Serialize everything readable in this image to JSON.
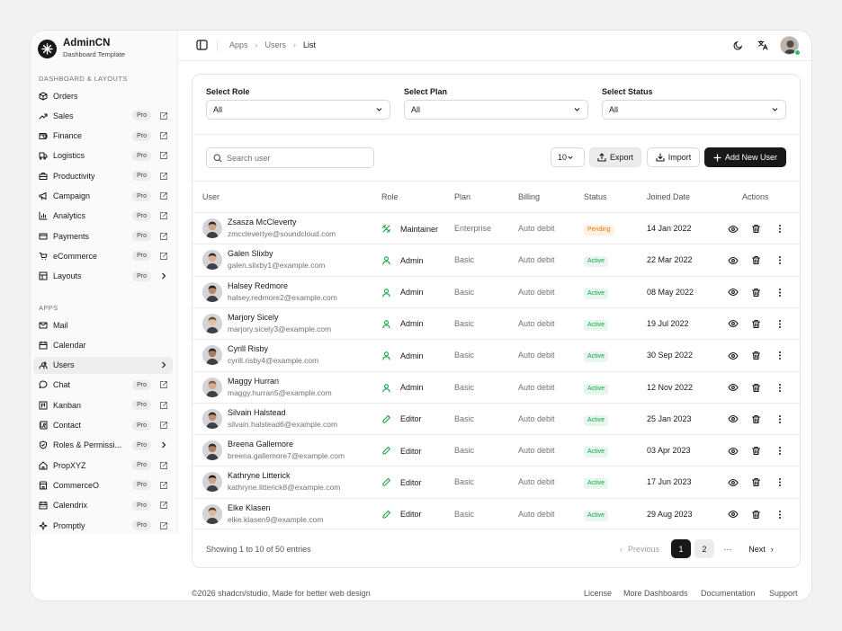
{
  "brand": {
    "name": "AdminCN",
    "subtitle": "Dashboard Template"
  },
  "sidebar": {
    "section1": "DASHBOARD & LAYOUTS",
    "section2": "APPS",
    "pro_label": "Pro",
    "items1": [
      {
        "label": "Orders",
        "icon": "box-icon",
        "pro": false,
        "trail": "none"
      },
      {
        "label": "Sales",
        "icon": "trending-up-icon",
        "pro": true,
        "trail": "external"
      },
      {
        "label": "Finance",
        "icon": "wallet-icon",
        "pro": true,
        "trail": "external"
      },
      {
        "label": "Logistics",
        "icon": "truck-icon",
        "pro": true,
        "trail": "external"
      },
      {
        "label": "Productivity",
        "icon": "briefcase-icon",
        "pro": true,
        "trail": "external"
      },
      {
        "label": "Campaign",
        "icon": "megaphone-icon",
        "pro": true,
        "trail": "external"
      },
      {
        "label": "Analytics",
        "icon": "bar-chart-icon",
        "pro": true,
        "trail": "external"
      },
      {
        "label": "Payments",
        "icon": "credit-card-icon",
        "pro": true,
        "trail": "external"
      },
      {
        "label": "eCommerce",
        "icon": "cart-icon",
        "pro": true,
        "trail": "external"
      },
      {
        "label": "Layouts",
        "icon": "layout-icon",
        "pro": true,
        "trail": "chevron"
      }
    ],
    "items2": [
      {
        "label": "Mail",
        "icon": "mail-icon",
        "pro": false,
        "trail": "none"
      },
      {
        "label": "Calendar",
        "icon": "calendar-icon",
        "pro": false,
        "trail": "none"
      },
      {
        "label": "Users",
        "icon": "users-icon",
        "pro": false,
        "trail": "chevron",
        "active": true
      },
      {
        "label": "Chat",
        "icon": "chat-icon",
        "pro": true,
        "trail": "external"
      },
      {
        "label": "Kanban",
        "icon": "kanban-icon",
        "pro": true,
        "trail": "external"
      },
      {
        "label": "Contact",
        "icon": "contact-icon",
        "pro": true,
        "trail": "external"
      },
      {
        "label": "Roles & Permissi...",
        "icon": "shield-icon",
        "pro": true,
        "trail": "chevron"
      },
      {
        "label": "PropXYZ",
        "icon": "home-icon",
        "pro": true,
        "trail": "external"
      },
      {
        "label": "CommerceO",
        "icon": "store-icon",
        "pro": true,
        "trail": "external"
      },
      {
        "label": "Calendrix",
        "icon": "calendar-days-icon",
        "pro": true,
        "trail": "external"
      },
      {
        "label": "Promptly",
        "icon": "sparkle-icon",
        "pro": true,
        "trail": "external"
      }
    ]
  },
  "breadcrumb": [
    "Apps",
    "Users",
    "List"
  ],
  "filters": [
    {
      "label": "Select Role",
      "value": "All"
    },
    {
      "label": "Select Plan",
      "value": "All"
    },
    {
      "label": "Select Status",
      "value": "All"
    }
  ],
  "toolbar": {
    "search_placeholder": "Search user",
    "page_size": "10",
    "export": "Export",
    "import": "Import",
    "add": "Add New User"
  },
  "table": {
    "headers": [
      "User",
      "Role",
      "Plan",
      "Billing",
      "Status",
      "Joined Date",
      "Actions"
    ],
    "rows": [
      {
        "name": "Zsasza McCleverty",
        "email": "zmcclevertye@soundcloud.com",
        "role": "Maintainer",
        "plan": "Enterprise",
        "billing": "Auto debit",
        "status": "Pending",
        "joined": "14 Jan 2022"
      },
      {
        "name": "Galen Slixby",
        "email": "galen.slixby1@example.com",
        "role": "Admin",
        "plan": "Basic",
        "billing": "Auto debit",
        "status": "Active",
        "joined": "22 Mar 2022"
      },
      {
        "name": "Halsey Redmore",
        "email": "halsey.redmore2@example.com",
        "role": "Admin",
        "plan": "Basic",
        "billing": "Auto debit",
        "status": "Active",
        "joined": "08 May 2022"
      },
      {
        "name": "Marjory Sicely",
        "email": "marjory.sicely3@example.com",
        "role": "Admin",
        "plan": "Basic",
        "billing": "Auto debit",
        "status": "Active",
        "joined": "19 Jul 2022"
      },
      {
        "name": "Cyrill Risby",
        "email": "cyrill.risby4@example.com",
        "role": "Admin",
        "plan": "Basic",
        "billing": "Auto debit",
        "status": "Active",
        "joined": "30 Sep 2022"
      },
      {
        "name": "Maggy Hurran",
        "email": "maggy.hurran5@example.com",
        "role": "Admin",
        "plan": "Basic",
        "billing": "Auto debit",
        "status": "Active",
        "joined": "12 Nov 2022"
      },
      {
        "name": "Silvain Halstead",
        "email": "silvain.halstead6@example.com",
        "role": "Editor",
        "plan": "Basic",
        "billing": "Auto debit",
        "status": "Active",
        "joined": "25 Jan 2023"
      },
      {
        "name": "Breena Gallemore",
        "email": "breena.gallemore7@example.com",
        "role": "Editor",
        "plan": "Basic",
        "billing": "Auto debit",
        "status": "Active",
        "joined": "03 Apr 2023"
      },
      {
        "name": "Kathryne Litterick",
        "email": "kathryne.litterick8@example.com",
        "role": "Editor",
        "plan": "Basic",
        "billing": "Auto debit",
        "status": "Active",
        "joined": "17 Jun 2023"
      },
      {
        "name": "Elke Klasen",
        "email": "elke.klasen9@example.com",
        "role": "Editor",
        "plan": "Basic",
        "billing": "Auto debit",
        "status": "Active",
        "joined": "29 Aug 2023"
      }
    ]
  },
  "pagination": {
    "info": "Showing 1 to 10 of 50 entries",
    "previous": "Previous",
    "pages": [
      "1",
      "2"
    ],
    "ellipsis": "···",
    "next": "Next"
  },
  "footer": {
    "copyright": "©2026 shadcn/studio, Made for better web design",
    "links": [
      "License",
      "More Dashboards",
      "Documentation",
      "Support"
    ]
  },
  "colors": {
    "accent": "#18181b",
    "active_badge": "#16a34a",
    "pending_badge": "#ea7b10",
    "role_icon": "#16a34a"
  }
}
